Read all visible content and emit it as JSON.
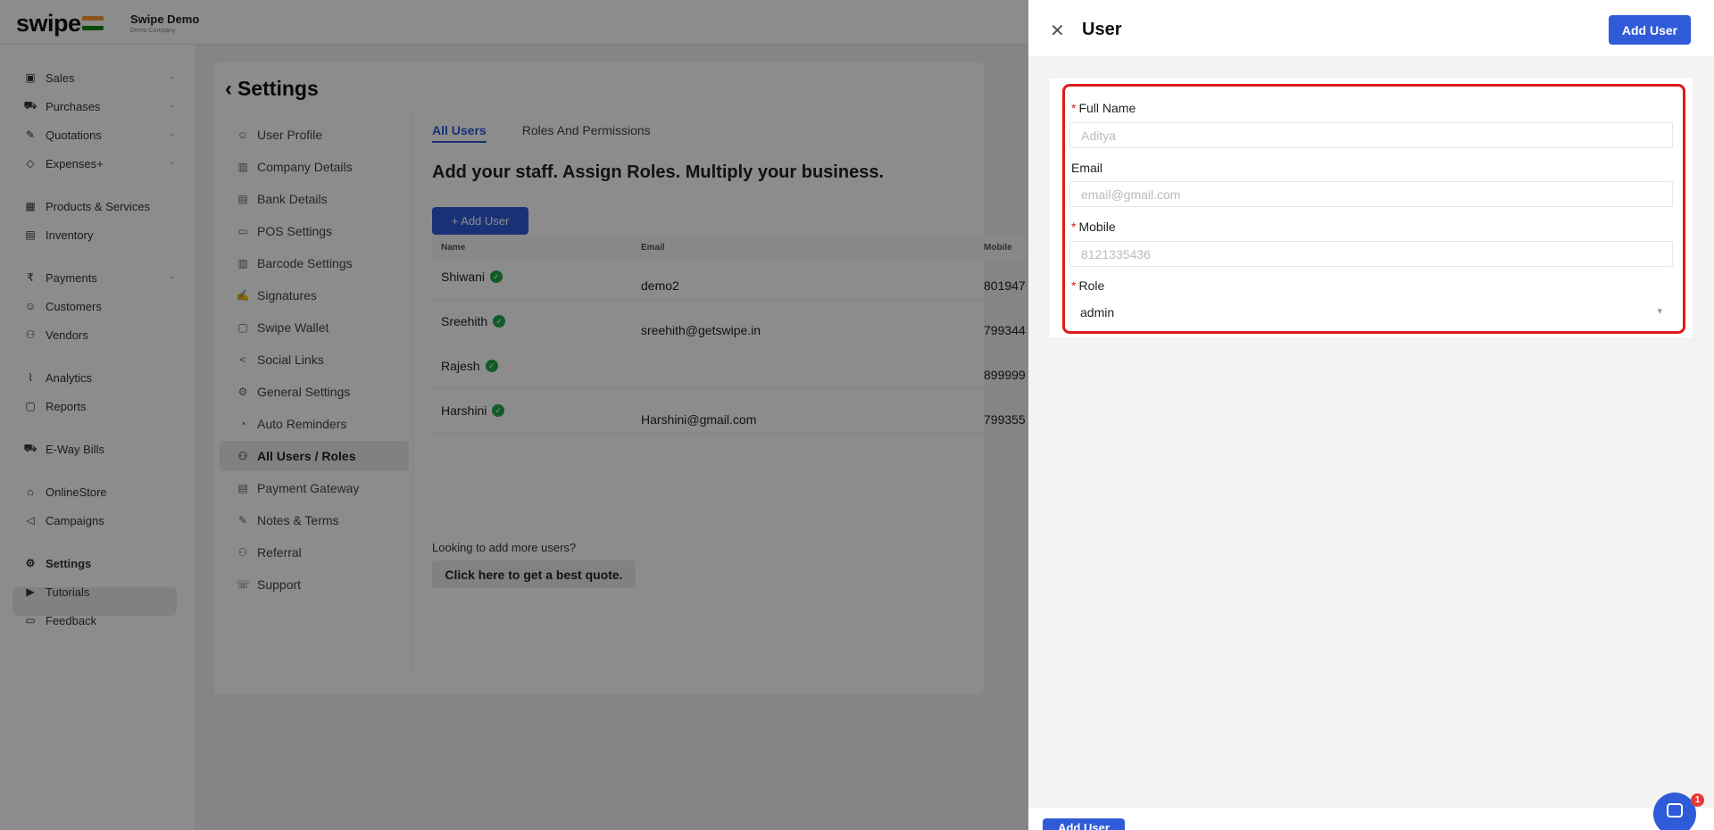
{
  "brand": {
    "logo": "swipe",
    "company_name": "Swipe Demo",
    "company_sub": "Demo Company"
  },
  "nav": [
    {
      "label": "Sales",
      "icon": "sales-icon",
      "chevron": true
    },
    {
      "label": "Purchases",
      "icon": "cart-icon",
      "chevron": true
    },
    {
      "label": "Quotations",
      "icon": "pen-icon",
      "chevron": true
    },
    {
      "label": "Expenses+",
      "icon": "tag-icon",
      "chevron": true
    },
    {
      "label": "Products & Services",
      "icon": "box-icon",
      "chevron": false
    },
    {
      "label": "Inventory",
      "icon": "inventory-icon",
      "chevron": false
    },
    {
      "label": "Payments",
      "icon": "rupee-icon",
      "chevron": true
    },
    {
      "label": "Customers",
      "icon": "user-icon",
      "chevron": false
    },
    {
      "label": "Vendors",
      "icon": "users-icon",
      "chevron": false
    },
    {
      "label": "Analytics",
      "icon": "chart-icon",
      "chevron": false
    },
    {
      "label": "Reports",
      "icon": "report-icon",
      "chevron": false
    },
    {
      "label": "E-Way Bills",
      "icon": "truck-icon",
      "chevron": false
    },
    {
      "label": "OnlineStore",
      "icon": "store-icon",
      "chevron": false
    },
    {
      "label": "Campaigns",
      "icon": "megaphone-icon",
      "chevron": false
    },
    {
      "label": "Settings",
      "icon": "gear-icon",
      "chevron": false,
      "active": true
    },
    {
      "label": "Tutorials",
      "icon": "youtube-icon",
      "chevron": false
    },
    {
      "label": "Feedback",
      "icon": "message-icon",
      "chevron": false
    }
  ],
  "settings": {
    "title": "Settings",
    "menu": [
      "User Profile",
      "Company Details",
      "Bank Details",
      "POS Settings",
      "Barcode Settings",
      "Signatures",
      "Swipe Wallet",
      "Social Links",
      "General Settings",
      "Auto Reminders",
      "All Users / Roles",
      "Payment Gateway",
      "Notes & Terms",
      "Referral",
      "Support"
    ],
    "active_menu": "All Users / Roles"
  },
  "users_page": {
    "tabs": [
      "All Users",
      "Roles And Permissions"
    ],
    "headline": "Add your staff. Assign Roles. Multiply your business.",
    "add_button": "+ Add User",
    "columns": {
      "name": "Name",
      "email": "Email",
      "mobile": "Mobile"
    },
    "rows": [
      {
        "name": "Shiwani",
        "email": "demo2",
        "mobile": "801947"
      },
      {
        "name": "Sreehith",
        "email": "sreehith@getswipe.in",
        "mobile": "799344"
      },
      {
        "name": "Rajesh",
        "email": "",
        "mobile": "899999"
      },
      {
        "name": "Harshini",
        "email": "Harshini@gmail.com",
        "mobile": "799355"
      }
    ],
    "more_text": "Looking to add more users?",
    "quote_button": "Click here to get a best quote."
  },
  "drawer": {
    "title": "User",
    "add_top": "Add User",
    "add_bottom": "Add User",
    "fields": {
      "full_name": {
        "label": "Full Name",
        "placeholder": "Aditya",
        "value": ""
      },
      "email": {
        "label": "Email",
        "placeholder": "email@gmail.com",
        "value": ""
      },
      "mobile": {
        "label": "Mobile",
        "placeholder": "8121335436",
        "value": ""
      },
      "role": {
        "label": "Role",
        "value": "admin"
      }
    }
  },
  "chat": {
    "badge": "1"
  },
  "colors": {
    "primary": "#2f5bd9",
    "highlight": "#e01a1a",
    "success": "#22a64a"
  }
}
